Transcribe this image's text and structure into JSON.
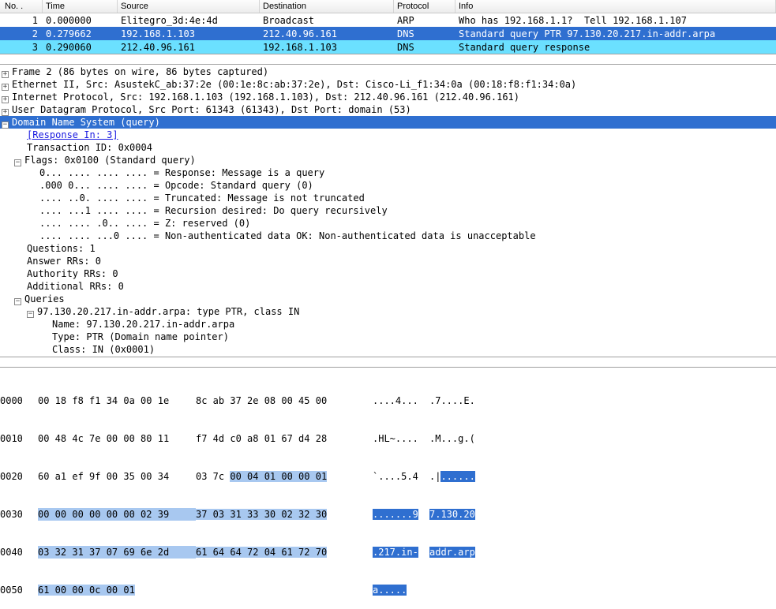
{
  "columns": {
    "no": "No. .",
    "time": "Time",
    "source": "Source",
    "dest": "Destination",
    "proto": "Protocol",
    "info": "Info"
  },
  "packets": [
    {
      "no": "1",
      "time": "0.000000",
      "source": "Elitegro_3d:4e:4d",
      "dest": "Broadcast",
      "proto": "ARP",
      "info": "Who has 192.168.1.1?  Tell 192.168.1.107"
    },
    {
      "no": "2",
      "time": "0.279662",
      "source": "192.168.1.103",
      "dest": "212.40.96.161",
      "proto": "DNS",
      "info": "Standard query PTR 97.130.20.217.in-addr.arpa"
    },
    {
      "no": "3",
      "time": "0.290060",
      "source": "212.40.96.161",
      "dest": "192.168.1.103",
      "proto": "DNS",
      "info": "Standard query response"
    }
  ],
  "tree": {
    "frame": "Frame 2 (86 bytes on wire, 86 bytes captured)",
    "eth": "Ethernet II, Src: AsustekC_ab:37:2e (00:1e:8c:ab:37:2e), Dst: Cisco-Li_f1:34:0a (00:18:f8:f1:34:0a)",
    "ip": "Internet Protocol, Src: 192.168.1.103 (192.168.1.103), Dst: 212.40.96.161 (212.40.96.161)",
    "udp": "User Datagram Protocol, Src Port: 61343 (61343), Dst Port: domain (53)",
    "dns": "Domain Name System (query)",
    "resp_in": "[Response In: 3]",
    "txid": "Transaction ID: 0x0004",
    "flags": "Flags: 0x0100 (Standard query)",
    "f0": "0... .... .... .... = Response: Message is a query",
    "f1": ".000 0... .... .... = Opcode: Standard query (0)",
    "f2": ".... ..0. .... .... = Truncated: Message is not truncated",
    "f3": ".... ...1 .... .... = Recursion desired: Do query recursively",
    "f4": ".... .... .0.. .... = Z: reserved (0)",
    "f5": ".... .... ...0 .... = Non-authenticated data OK: Non-authenticated data is unacceptable",
    "questions": "Questions: 1",
    "ans": "Answer RRs: 0",
    "auth": "Authority RRs: 0",
    "addl": "Additional RRs: 0",
    "queries": "Queries",
    "q0": "97.130.20.217.in-addr.arpa: type PTR, class IN",
    "qname": "Name: 97.130.20.217.in-addr.arpa",
    "qtype": "Type: PTR (Domain name pointer)",
    "qclass": "Class: IN (0x0001)"
  },
  "hex": {
    "r0": {
      "off": "0000",
      "b1": "00 18 f8 f1 34 0a 00 1e",
      "b2": "8c ab 37 2e 08 00 45 00",
      "a1": "....4...",
      "a2": ".7....E."
    },
    "r1": {
      "off": "0010",
      "b1": "00 48 4c 7e 00 00 80 11",
      "b2": "f7 4d c0 a8 01 67 d4 28",
      "a1": ".HL~....",
      "a2": ".M...g.("
    },
    "r2": {
      "off": "0020",
      "b1": "60 a1 ef 9f 00 35 00 34",
      "b2p": "03 7c ",
      "b2h": "00 04 01 00 00 01",
      "a1": "`....5.4",
      "a2p": ".|",
      "a2h": "......"
    },
    "r3": {
      "off": "0030",
      "b1": "00 00 00 00 00 00 02 39",
      "b2": "37 03 31 33 30 02 32 30",
      "a1p": ".......9",
      "a2": "7.130.20"
    },
    "r4": {
      "off": "0040",
      "b1": "03 32 31 37 07 69 6e 2d",
      "b2": "61 64 64 72 04 61 72 70",
      "a1": ".217.in-",
      "a2": "addr.arp"
    },
    "r5": {
      "off": "0050",
      "b1": "61 00 00 0c 00 01",
      "b2": "",
      "a1": "a.....",
      "a2": ""
    }
  }
}
